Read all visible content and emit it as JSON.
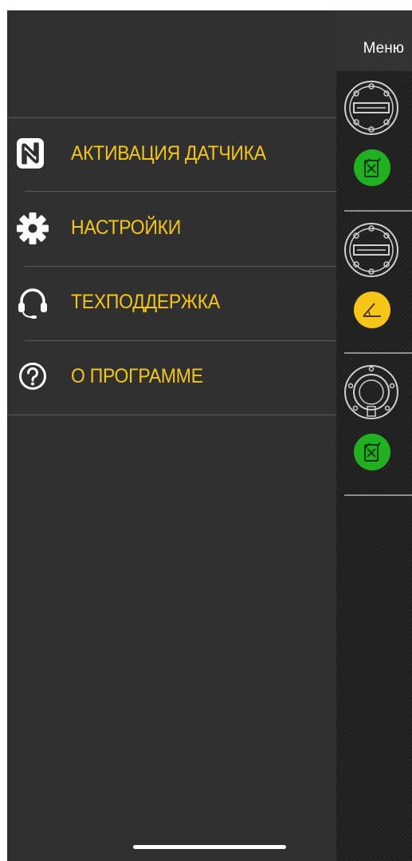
{
  "header": {
    "menu_label": "Меню"
  },
  "drawer": {
    "items": [
      {
        "label": "АКТИВАЦИЯ ДАТЧИКА",
        "icon": "nfc-icon"
      },
      {
        "label": "НАСТРОЙКИ",
        "icon": "gear-icon"
      },
      {
        "label": "ТЕХПОДДЕРЖКА",
        "icon": "headset-icon"
      },
      {
        "label": "О ПРОГРАММЕ",
        "icon": "question-circle-icon"
      }
    ]
  },
  "devices": [
    {
      "sensor_icon": "fuel-sensor-flange-icon",
      "status_icon": "fuel-can-icon",
      "status_color": "#20b020"
    },
    {
      "sensor_icon": "fuel-sensor-flange-icon",
      "status_icon": "tilt-angle-icon",
      "status_color": "#f5c518"
    },
    {
      "sensor_icon": "round-sensor-flange-icon",
      "status_icon": "fuel-can-icon",
      "status_color": "#20b020"
    }
  ],
  "colors": {
    "accent": "#f5c518",
    "background": "#333333",
    "text": "#ffffff"
  }
}
